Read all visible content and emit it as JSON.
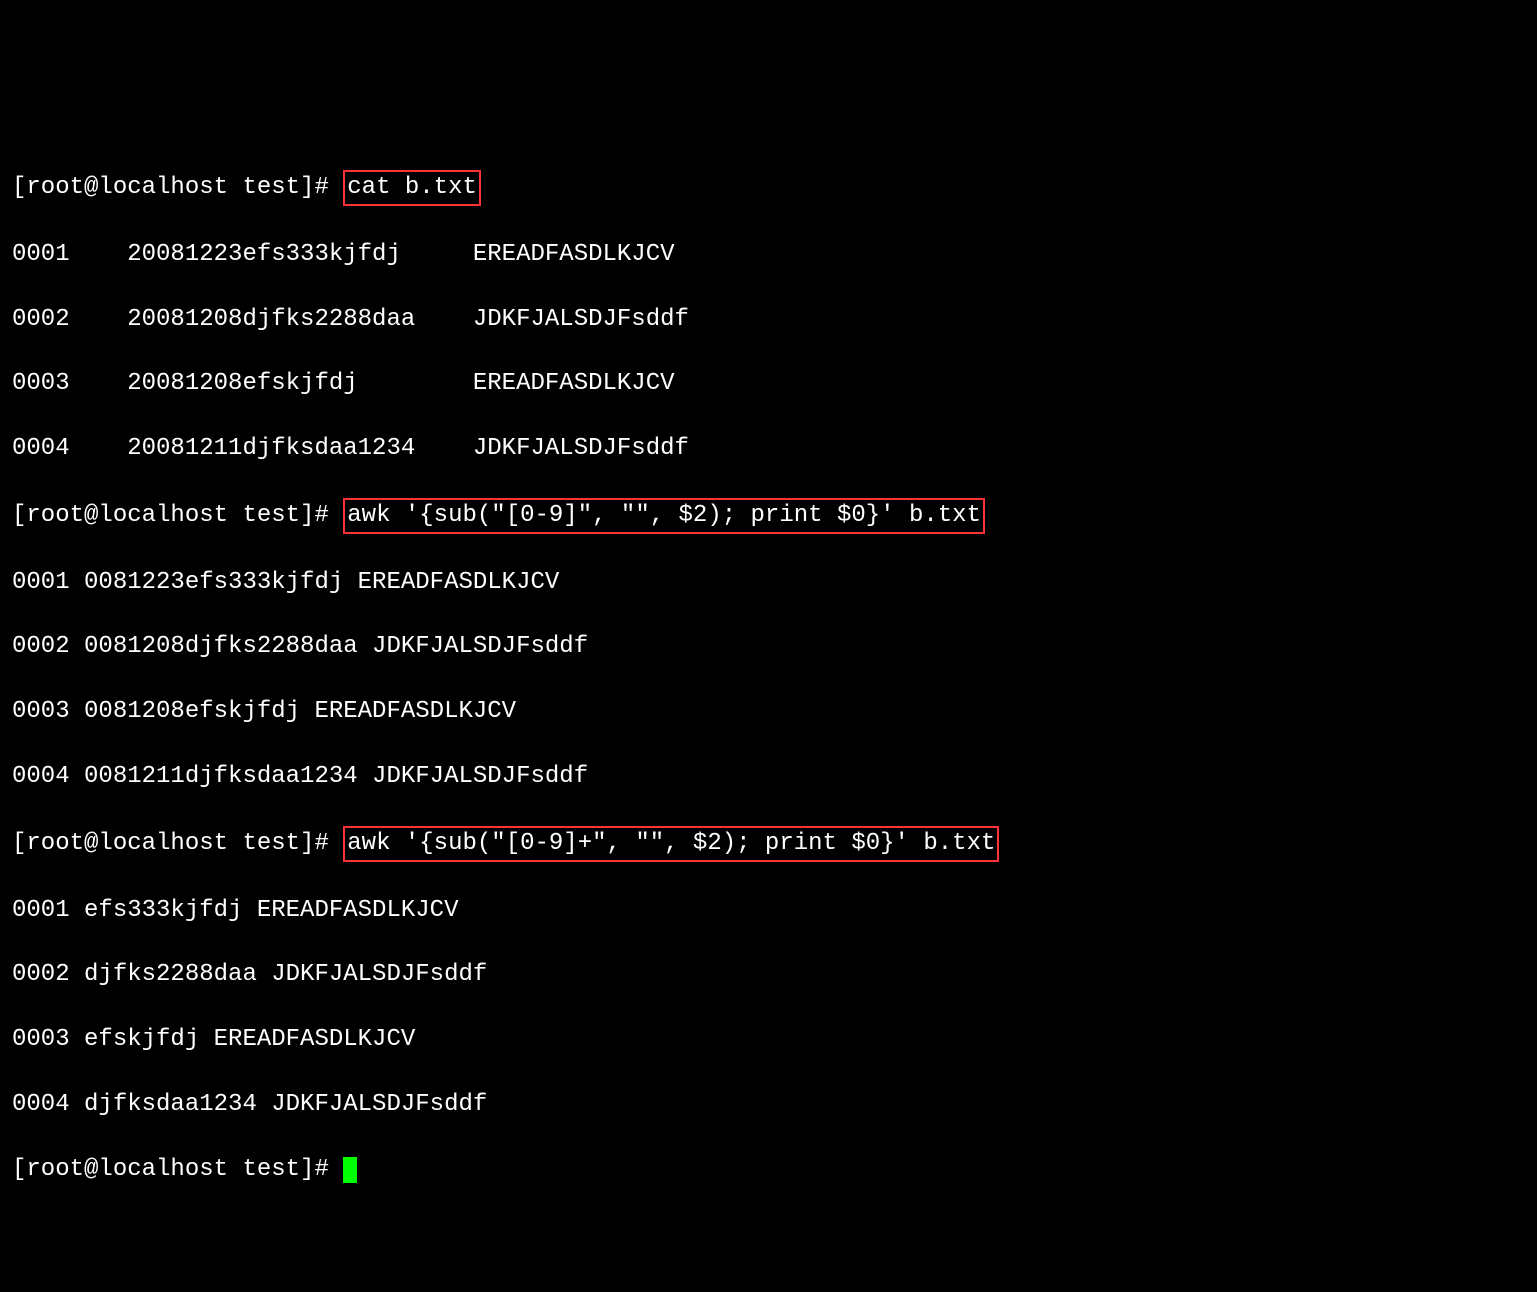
{
  "prompt": "[root@localhost test]# ",
  "cmd1": "cat b.txt",
  "cat_output": [
    "0001    20081223efs333kjfdj     EREADFASDLKJCV",
    "0002    20081208djfks2288daa    JDKFJALSDJFsddf",
    "0003    20081208efskjfdj        EREADFASDLKJCV",
    "0004    20081211djfksdaa1234    JDKFJALSDJFsddf"
  ],
  "cmd2": "awk '{sub(\"[0-9]\", \"\", $2); print $0}' b.txt",
  "awk1_output": [
    "0001 0081223efs333kjfdj EREADFASDLKJCV",
    "0002 0081208djfks2288daa JDKFJALSDJFsddf",
    "0003 0081208efskjfdj EREADFASDLKJCV",
    "0004 0081211djfksdaa1234 JDKFJALSDJFsddf"
  ],
  "cmd3": "awk '{sub(\"[0-9]+\", \"\", $2); print $0}' b.txt",
  "awk2_output": [
    "0001 efs333kjfdj EREADFASDLKJCV",
    "0002 djfks2288daa JDKFJALSDJFsddf",
    "0003 efskjfdj EREADFASDLKJCV",
    "0004 djfksdaa1234 JDKFJALSDJFsddf"
  ]
}
